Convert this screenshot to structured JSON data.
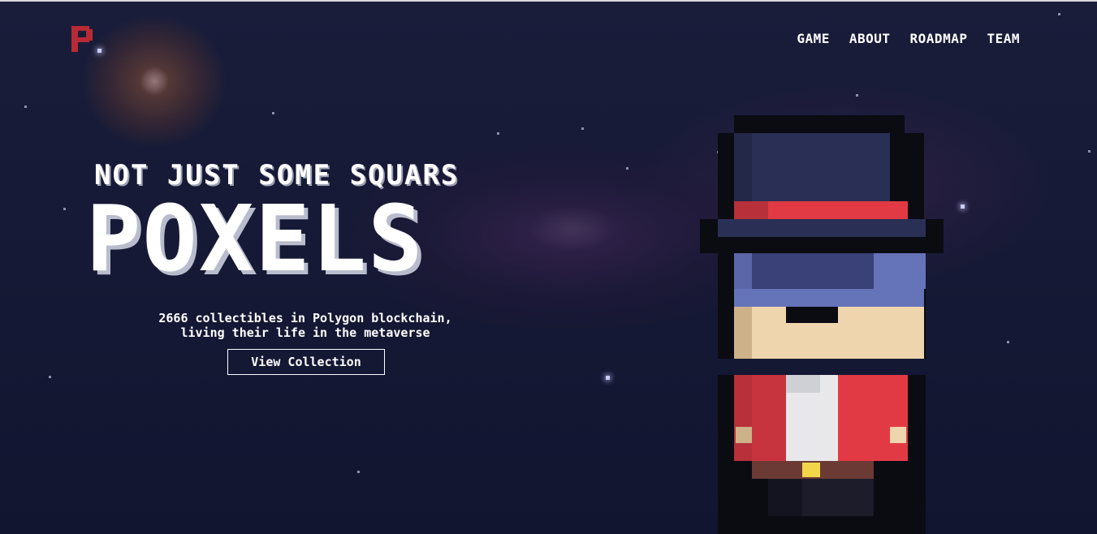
{
  "nav": {
    "items": [
      {
        "label": "GAME"
      },
      {
        "label": "ABOUT"
      },
      {
        "label": "ROADMAP"
      },
      {
        "label": "TEAM"
      }
    ]
  },
  "hero": {
    "eyebrow": "NOT JUST SOME SQUARS",
    "title": "POXELS",
    "description_line1": "2666 collectibles in Polygon blockchain,",
    "description_line2": "living their life in the metaverse",
    "cta_label": "View Collection"
  },
  "icons": {
    "logo": "pixel-p-logo",
    "character": "top-hat-pixel-character"
  },
  "colors": {
    "background": "#161a33",
    "logo": "#b82a34",
    "hat_band": "#e23a44",
    "text": "#ffffff"
  }
}
